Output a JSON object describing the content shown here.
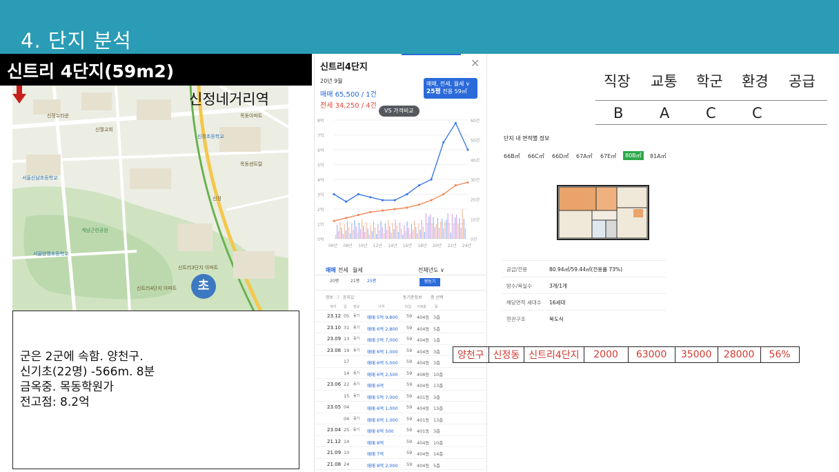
{
  "slide": {
    "title": "4. 단지 분석"
  },
  "complex": {
    "title": "신트리 4단지(59m2)"
  },
  "map": {
    "station_label": "신정네거리역",
    "school_badge": "초",
    "labels": [
      "신트리4단지 아파트",
      "신정초등학교",
      "계남근린공원",
      "서울신남초등학교",
      "신정뉴타운",
      "목동센트럴",
      "신트리3단지 아파트",
      "신월교회",
      "서울양명초등학교",
      "신정",
      "목동아파트",
      "신정네거리역"
    ]
  },
  "note": {
    "lines": [
      "군은 2군에 속함. 양천구.",
      "신기초(22명) -566m. 8분",
      "금옥중. 목동학원가",
      "전고점: 8.2억"
    ]
  },
  "app": {
    "name": "신트리4단지",
    "close_icon": "close-icon",
    "period": "20년 9월",
    "sale": "매매 65,500 / 1건",
    "rent": "전세 34,250 / 4건",
    "filter_line1": "매매, 전세, 월세 ∨",
    "filter_line2": "25평",
    "filter_line3": "전용 59㎡",
    "vs_button": "VS 가격비교",
    "tabs": {
      "sale": "매매",
      "jeonse": "전세",
      "wolse": "월세",
      "year": "전체년도 ∨"
    },
    "stats": {
      "a": "20평",
      "b": "21평",
      "c": "25평",
      "btn": "평등기"
    },
    "txn_head": {
      "left": "정보 · 〉 공지있",
      "right1": "동기준정보",
      "right2": "층 선택"
    },
    "txn_cols": [
      "계약",
      "일",
      "정보",
      "가격",
      "타입",
      "거래층",
      "동"
    ],
    "transactions": [
      {
        "date": "23.12",
        "day": "05",
        "type": "동기",
        "price": "매매 5억 9,800",
        "area": "59",
        "floor": "404동",
        "cnt": "3층"
      },
      {
        "date": "23.10",
        "day": "31",
        "type": "동기",
        "price": "매매 6억 2,800",
        "area": "59",
        "floor": "404동",
        "cnt": "5층"
      },
      {
        "date": "23.09",
        "day": "13",
        "type": "동기",
        "price": "매매 5억 7,000",
        "area": "59",
        "floor": "404동",
        "cnt": "1층"
      },
      {
        "date": "23.08",
        "day": "19",
        "type": "동기",
        "price": "매매 6억 1,000",
        "area": "59",
        "floor": "404동",
        "cnt": "3층"
      },
      {
        "date": "",
        "day": "17",
        "type": "",
        "price": "매매 6억 5,000",
        "area": "59",
        "floor": "404동",
        "cnt": "3층"
      },
      {
        "date": "",
        "day": "14",
        "type": "동기",
        "price": "매매 6억 2,500",
        "area": "59",
        "floor": "408동",
        "cnt": "10층"
      },
      {
        "date": "23.06",
        "day": "22",
        "type": "동기",
        "price": "매매 6억",
        "area": "59",
        "floor": "404동",
        "cnt": "13층"
      },
      {
        "date": "",
        "day": "15",
        "type": "동기",
        "price": "매매 5억 7,000",
        "area": "59",
        "floor": "401동",
        "cnt": "3층"
      },
      {
        "date": "23.05",
        "day": "04",
        "type": "",
        "price": "매매 6억 1,000",
        "area": "59",
        "floor": "404동",
        "cnt": "13층"
      },
      {
        "date": "",
        "day": "04",
        "type": "동기",
        "price": "매매 6억 1,000",
        "area": "59",
        "floor": "401동",
        "cnt": "13층"
      },
      {
        "date": "23.04",
        "day": "25",
        "type": "동기",
        "price": "매매 6억 500",
        "area": "59",
        "floor": "401동",
        "cnt": "3층"
      },
      {
        "date": "21.12",
        "day": "14",
        "type": "",
        "price": "매매 8억",
        "area": "59",
        "floor": "404동",
        "cnt": "10층"
      },
      {
        "date": "21.09",
        "day": "10",
        "type": "",
        "price": "매매 7억",
        "area": "59",
        "floor": "404동",
        "cnt": "14층"
      },
      {
        "date": "21.08",
        "day": "24",
        "type": "",
        "price": "매매 8억 2,000",
        "area": "59",
        "floor": "404동",
        "cnt": "5층"
      }
    ]
  },
  "chart_data": {
    "type": "line",
    "x": [
      "06년",
      "08년",
      "10년",
      "12년",
      "14년",
      "16년",
      "18년",
      "20년",
      "22년",
      "24년"
    ],
    "y_left_ticks": [
      "8억",
      "7억",
      "6억",
      "5억",
      "4억",
      "3억",
      "2억",
      "1억",
      "0억"
    ],
    "y_right_ticks": [
      "60건",
      "50건",
      "40건",
      "30건",
      "20건",
      "10건",
      "0건"
    ],
    "series": [
      {
        "name": "매매",
        "color": "#3b78e7",
        "values": [
          3.0,
          2.5,
          3.0,
          2.8,
          2.6,
          2.6,
          3.0,
          3.6,
          4.0,
          6.5,
          7.8,
          6.0
        ]
      },
      {
        "name": "전세",
        "color": "#ef8a5b",
        "values": [
          1.2,
          1.4,
          1.6,
          1.8,
          1.9,
          2.0,
          2.1,
          2.3,
          2.6,
          3.0,
          3.6,
          3.8
        ]
      }
    ]
  },
  "evaluation": {
    "headers": [
      "직장",
      "교통",
      "학군",
      "환경",
      "공급"
    ],
    "grades": [
      "B",
      "A",
      "C",
      "C",
      ""
    ]
  },
  "plan": {
    "title": "단지 내 면적별 정보",
    "tabs": [
      "66B㎡",
      "66C㎡",
      "66D㎡",
      "67A㎡",
      "67E㎡",
      "80B㎡",
      "81A㎡"
    ],
    "active_tab": "80B㎡",
    "info": [
      {
        "k": "공급/전용",
        "v": "80.94㎡/59.44㎡(전용률 73%)"
      },
      {
        "k": "방수/욕실수",
        "v": "3개/1개"
      },
      {
        "k": "해당면적 세대수",
        "v": "16세대"
      },
      {
        "k": "현관구조",
        "v": "복도식"
      }
    ]
  },
  "table": {
    "cells": [
      "양천구",
      "신정동",
      "신트리4단지",
      "2000",
      "63000",
      "35000",
      "28000",
      "56%"
    ]
  }
}
